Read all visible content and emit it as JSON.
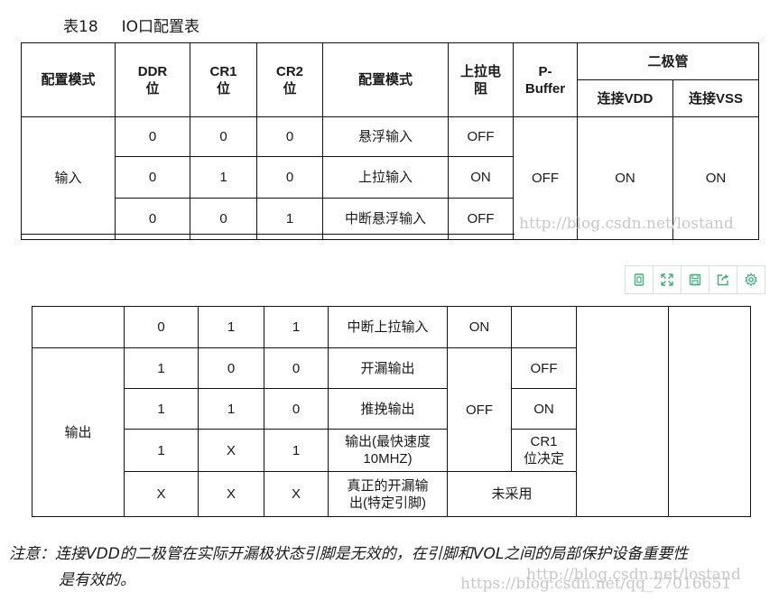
{
  "caption": {
    "number": "表18",
    "title": "IO口配置表"
  },
  "headers": {
    "mode": "配置模式",
    "ddr": [
      "DDR",
      "位"
    ],
    "cr1": [
      "CR1",
      "位"
    ],
    "cr2": [
      "CR2",
      "位"
    ],
    "config": "配置模式",
    "pullup": [
      "上拉电",
      "阻"
    ],
    "pbuffer": [
      "P-",
      "Buffer"
    ],
    "diode": "二极管",
    "diode_vdd": "连接VDD",
    "diode_vss": "连接VSS"
  },
  "input_section": {
    "mode": "输入",
    "pbuffer": "OFF",
    "diode_vdd": "ON",
    "diode_vss": "ON",
    "rows": [
      {
        "ddr": "0",
        "cr1": "0",
        "cr2": "0",
        "config": "悬浮输入",
        "pullup": "OFF"
      },
      {
        "ddr": "0",
        "cr1": "1",
        "cr2": "0",
        "config": "上拉输入",
        "pullup": "ON"
      },
      {
        "ddr": "0",
        "cr1": "0",
        "cr2": "1",
        "config": "中断悬浮输入",
        "pullup": "OFF"
      }
    ],
    "continued_row": {
      "ddr": "0",
      "cr1": "1",
      "cr2": "1",
      "config": "中断上拉输入",
      "pullup": "ON"
    }
  },
  "output_section": {
    "mode": "输出",
    "pullup_merged": "OFF",
    "rows": [
      {
        "ddr": "1",
        "cr1": "0",
        "cr2": "0",
        "config": "开漏输出",
        "pbuffer": "OFF"
      },
      {
        "ddr": "1",
        "cr1": "1",
        "cr2": "0",
        "config": "推挽输出",
        "pbuffer": "ON"
      },
      {
        "ddr": "1",
        "cr1": "X",
        "cr2": "1",
        "config": [
          "输出(最快速度",
          "10MHZ)"
        ],
        "pbuffer": [
          "CR1",
          "位决定"
        ]
      },
      {
        "ddr": "X",
        "cr1": "X",
        "cr2": "X",
        "config": [
          "真正的开漏输",
          "出(特定引脚)"
        ],
        "pullup_pbuffer": "未采用"
      }
    ]
  },
  "toolbar": {
    "icons": [
      "copy-icon",
      "expand-icon",
      "save-icon",
      "share-icon",
      "settings-icon"
    ],
    "accent": "#3fae7a"
  },
  "note": {
    "line1": "注意：连接VDD的二极管在实际开漏极状态引脚是无效的，在引脚和VOL之间的局部保护设备重要性",
    "line2": "是有效的。"
  },
  "watermarks": {
    "top": "http://blog.csdn.net/lostand",
    "bottom_back": "http://blog.csdn.net/lostand",
    "bottom_front": "https://blog.csdn.net/qq_27016651"
  }
}
